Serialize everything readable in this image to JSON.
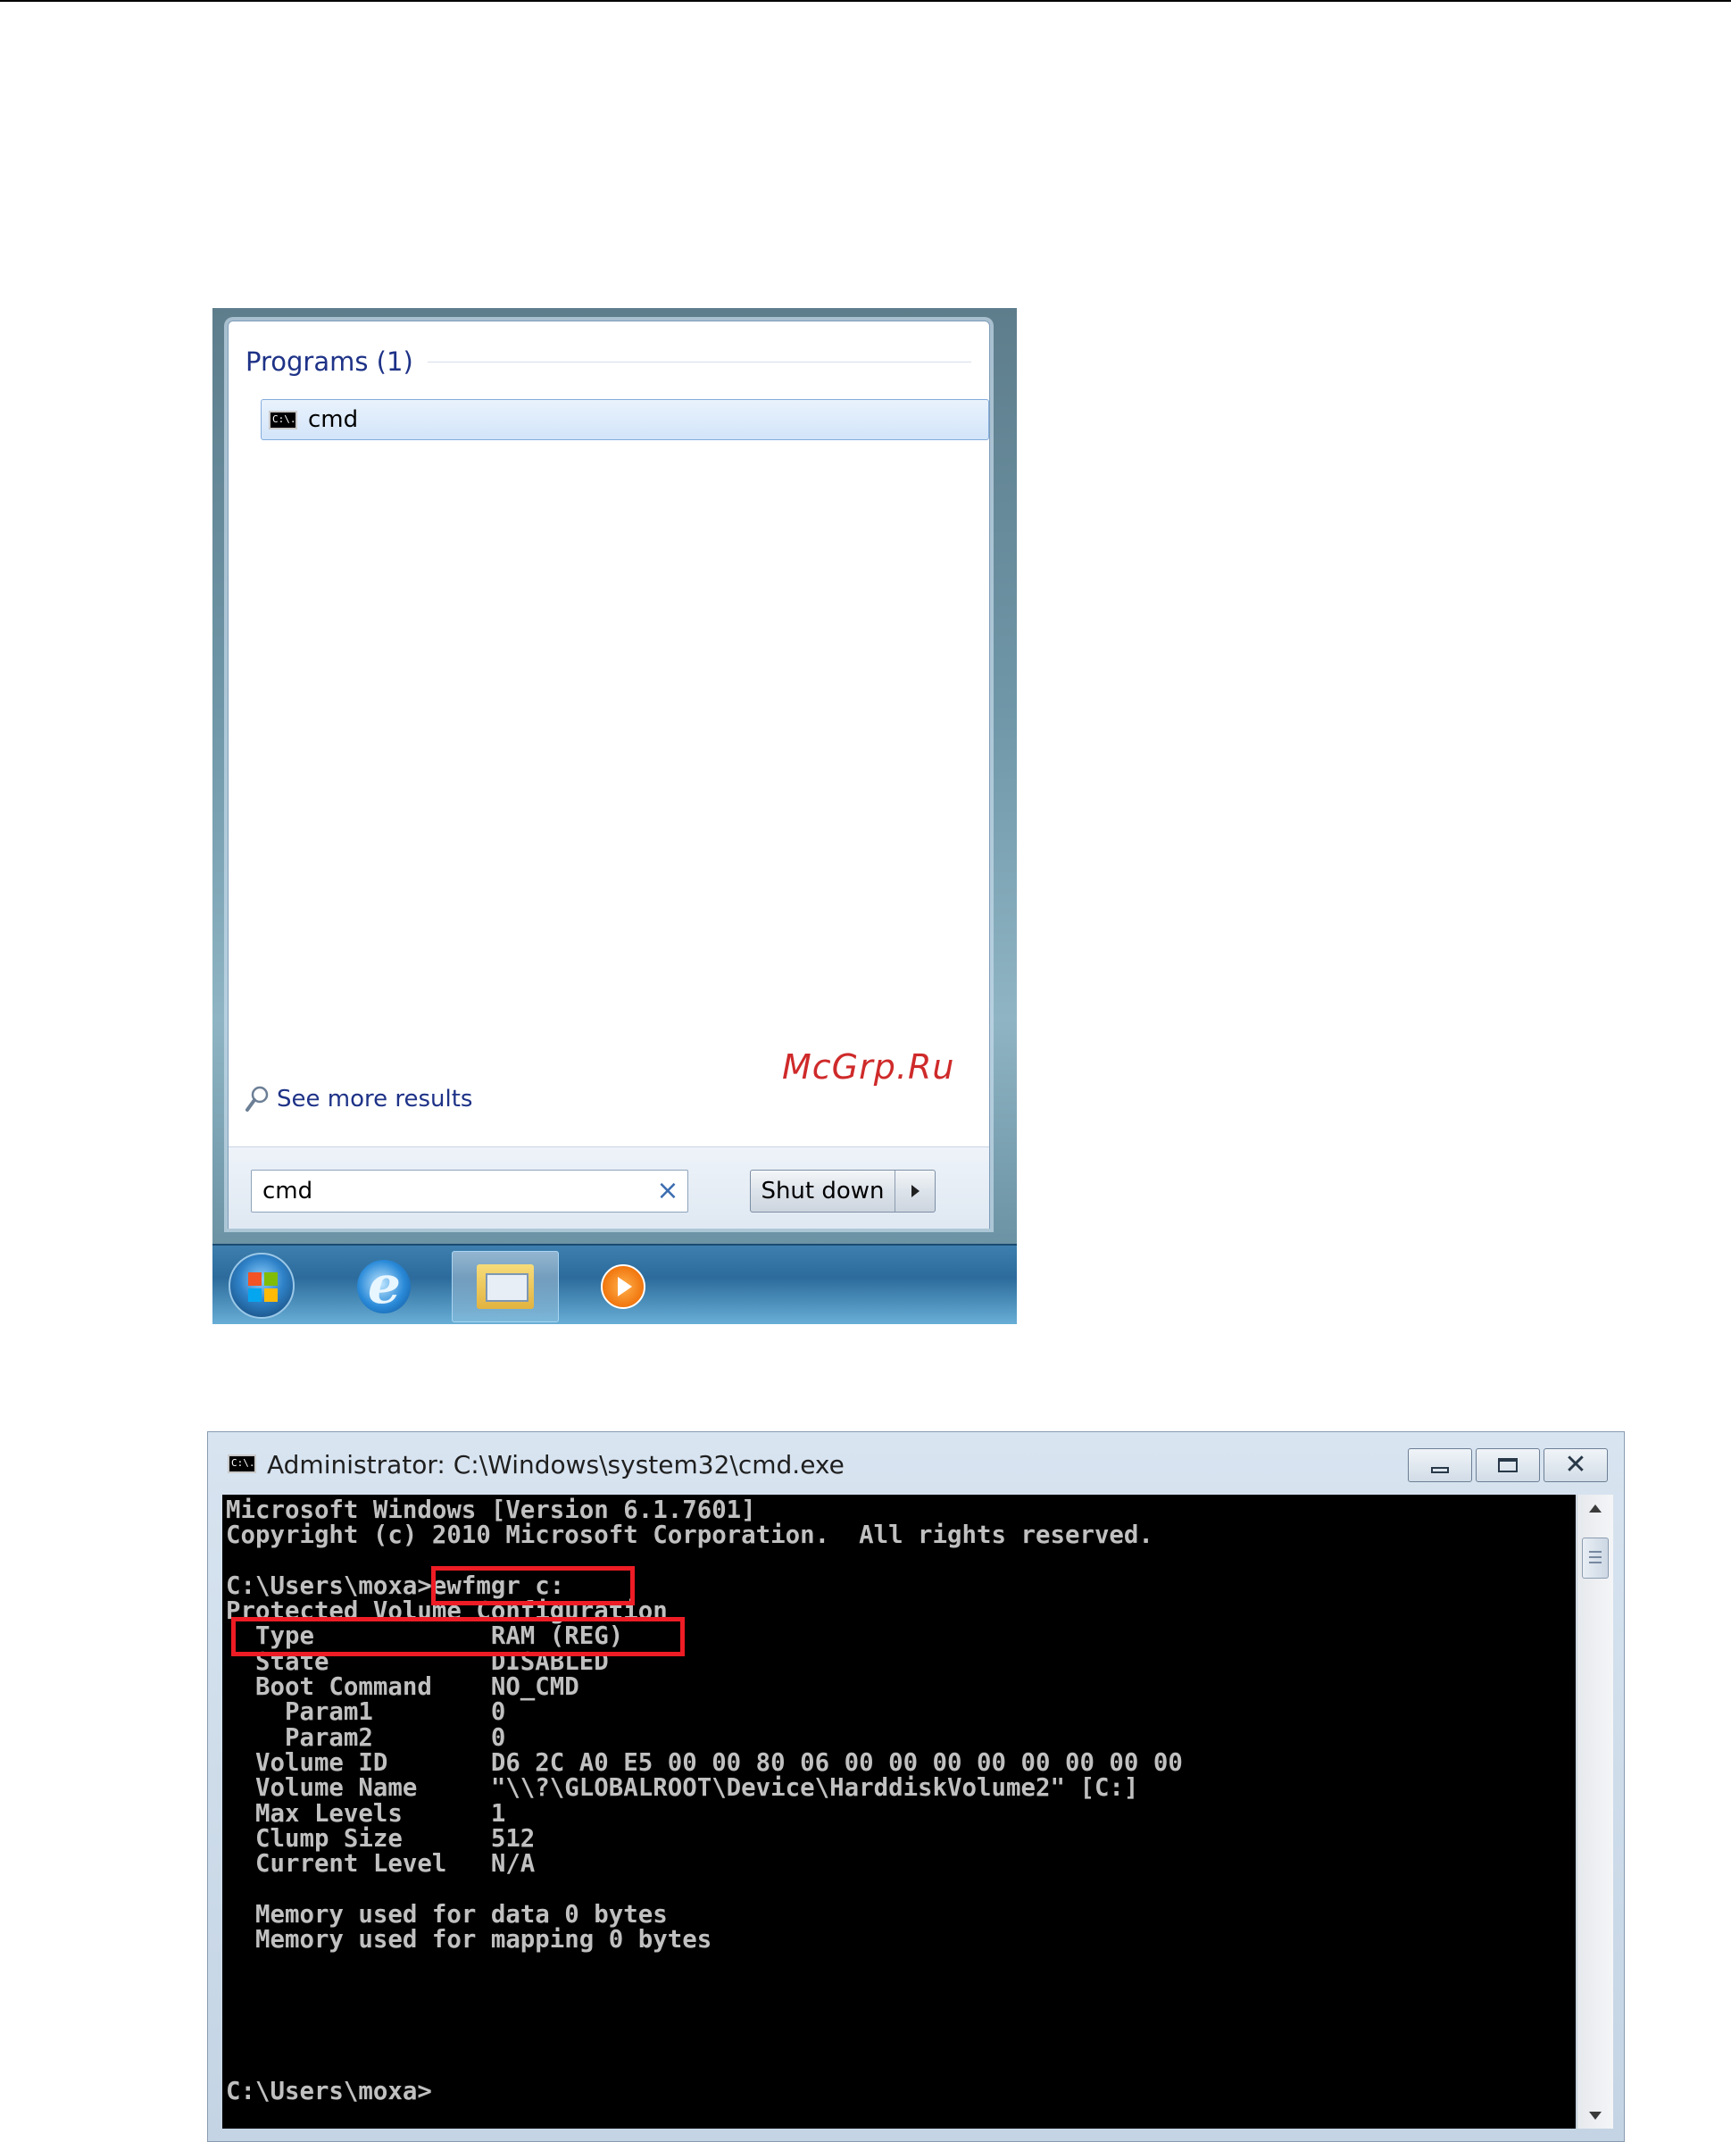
{
  "start_menu": {
    "programs_header": "Programs (1)",
    "result_item_label": "cmd",
    "see_more_results": "See more results",
    "search_value": "cmd",
    "search_clear": "×",
    "shutdown_label": "Shut down"
  },
  "watermark": "McGrp.Ru",
  "cmd_window": {
    "title": "Administrator: C:\\Windows\\system32\\cmd.exe",
    "console_lines": [
      "Microsoft Windows [Version 6.1.7601]",
      "Copyright (c) 2010 Microsoft Corporation.  All rights reserved.",
      "",
      "C:\\Users\\moxa>ewfmgr c:",
      "Protected Volume Configuration",
      "  Type            RAM (REG)",
      "  State           DISABLED",
      "  Boot Command    NO_CMD",
      "    Param1        0",
      "    Param2        0",
      "  Volume ID       D6 2C A0 E5 00 00 80 06 00 00 00 00 00 00 00 00",
      "  Volume Name     \"\\\\?\\GLOBALROOT\\Device\\HarddiskVolume2\" [C:]",
      "  Max Levels      1",
      "  Clump Size      512",
      "  Current Level   N/A",
      "",
      "  Memory used for data 0 bytes",
      "  Memory used for mapping 0 bytes",
      "",
      "",
      "",
      "",
      "",
      "C:\\Users\\moxa>"
    ]
  },
  "colors": {
    "highlight_box": "#ee1c25",
    "link_text": "#1e3287",
    "console_text": "#c0c0c0"
  },
  "icons": [
    "search-icon",
    "clear-icon",
    "windows-orb-icon",
    "internet-explorer-icon",
    "file-explorer-icon",
    "media-player-icon",
    "cmd-icon",
    "minimize-icon",
    "maximize-icon",
    "close-icon"
  ]
}
